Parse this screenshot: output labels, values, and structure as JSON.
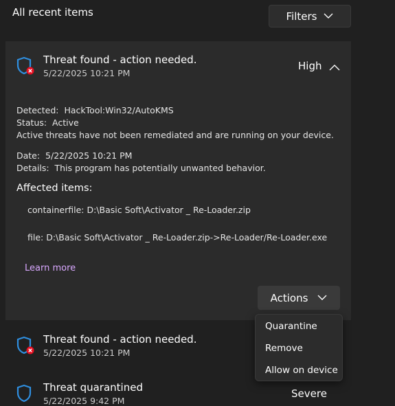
{
  "header": {
    "title": "All recent items",
    "filters_label": "Filters"
  },
  "colors": {
    "accent": "#0078d4",
    "danger": "#e81123",
    "link": "#d9a8ff"
  },
  "expanded": {
    "title": "Threat found - action needed.",
    "date": "5/22/2025 10:21 PM",
    "severity": "High",
    "detected_label": "Detected:",
    "detected_value": "HackTool:Win32/AutoKMS",
    "status_label": "Status:",
    "status_value": "Active",
    "status_description": "Active threats have not been remediated and are running on your device.",
    "date_label": "Date:",
    "date_value": "5/22/2025 10:21 PM",
    "details_label": "Details:",
    "details_value": "This program has potentially unwanted behavior.",
    "affected_heading": "Affected items:",
    "affected_items": [
      "containerfile: D:\\Basic Soft\\Activator _ Re-Loader.zip",
      "file: D:\\Basic Soft\\Activator _ Re-Loader.zip->Re-Loader/Re-Loader.exe"
    ],
    "learn_more": "Learn more",
    "actions_label": "Actions"
  },
  "actions_menu": [
    "Quarantine",
    "Remove",
    "Allow on device"
  ],
  "list": [
    {
      "title": "Threat found - action needed.",
      "date": "5/22/2025 10:21 PM"
    },
    {
      "title": "Threat quarantined",
      "date": "5/22/2025 9:42 PM",
      "severity": "Severe"
    }
  ]
}
